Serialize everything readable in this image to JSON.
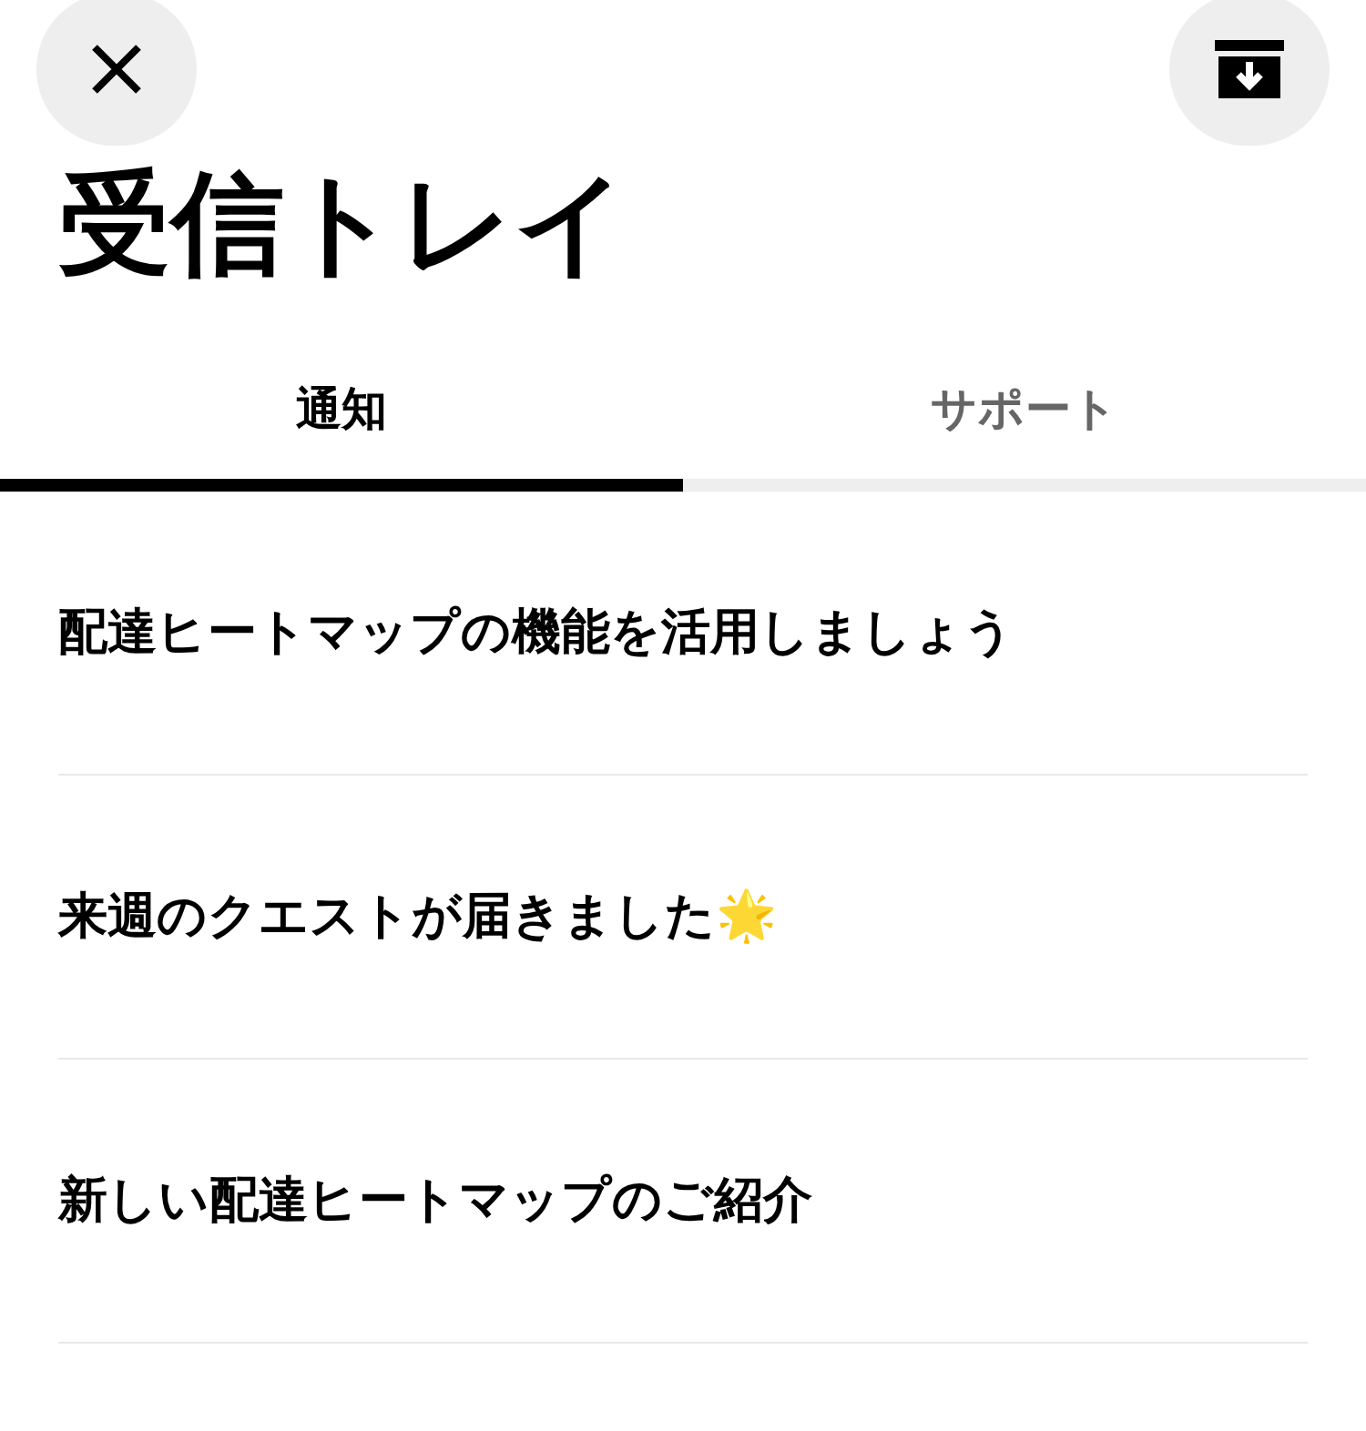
{
  "title": "受信トレイ",
  "tabs": [
    {
      "label": "通知",
      "selected": true
    },
    {
      "label": "サポート",
      "selected": false
    }
  ],
  "messages": [
    {
      "text": "配達ヒートマップの機能を活用しましょう"
    },
    {
      "text": "来週のクエストが届きました🌟"
    },
    {
      "text": "新しい配達ヒートマップのご紹介"
    }
  ]
}
